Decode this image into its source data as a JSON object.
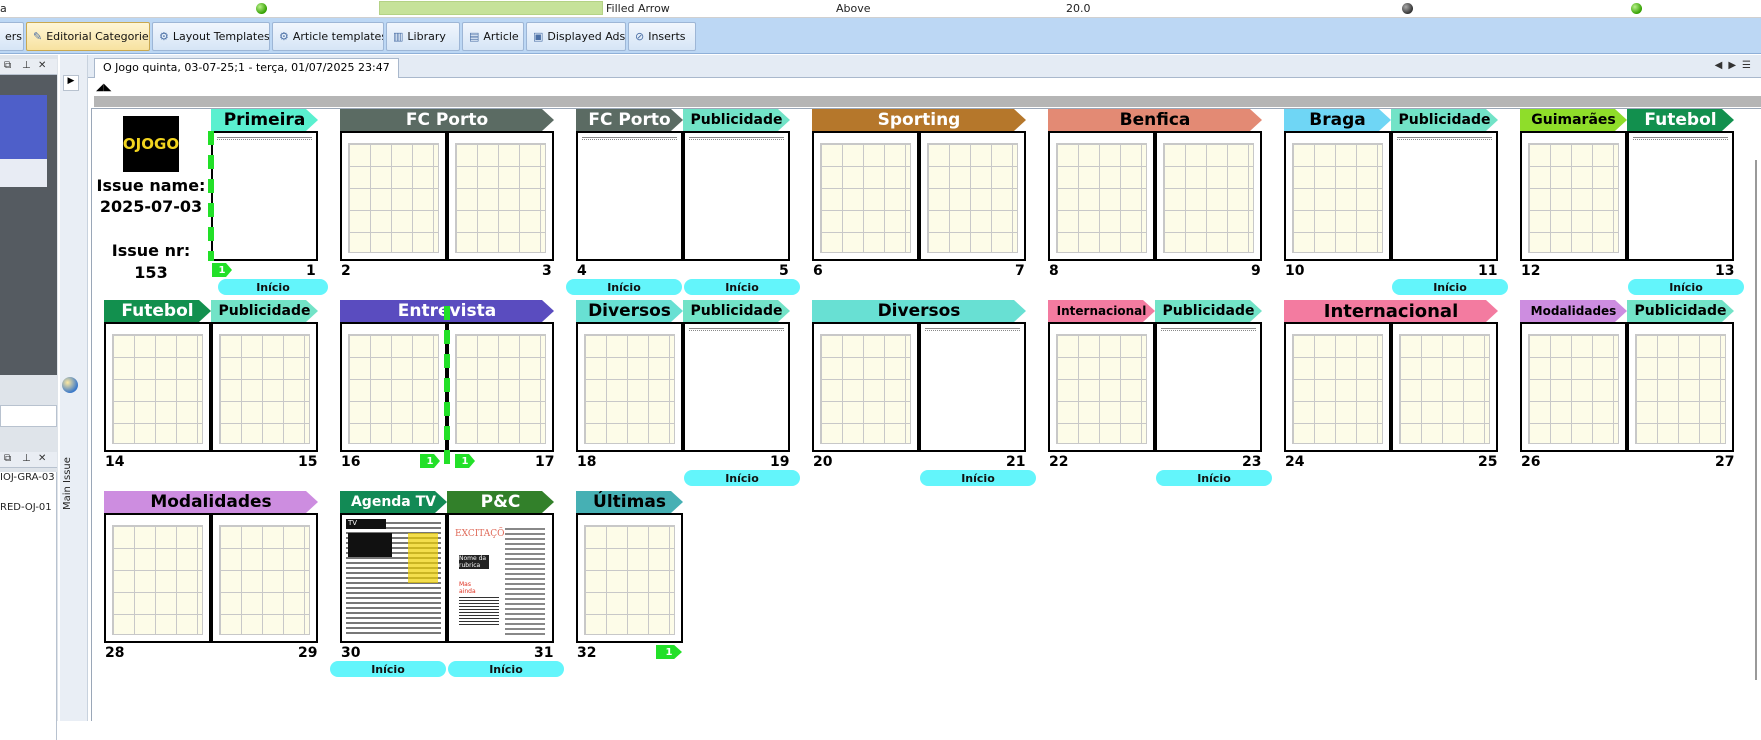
{
  "top_row": {
    "left_text": "a",
    "style_value": "Filled Arrow",
    "position_value": "Above",
    "size_value": "20.0"
  },
  "tabs": [
    {
      "label": "ers",
      "icon": "tab-icon"
    },
    {
      "label": "Editorial Categories",
      "icon": "pencil-icon"
    },
    {
      "label": "Layout Templates",
      "icon": "gear-icon"
    },
    {
      "label": "Article templates",
      "icon": "gear-icon"
    },
    {
      "label": "Library",
      "icon": "chart-icon"
    },
    {
      "label": "Article",
      "icon": "document-icon"
    },
    {
      "label": "Displayed Ads",
      "icon": "picture-icon"
    },
    {
      "label": "Inserts",
      "icon": "paperclip-icon"
    }
  ],
  "left_panel": {
    "items": [
      "IOJ-GRA-03",
      "RED-OJ-01"
    ]
  },
  "vertical_tab": "Main Issue",
  "document_tab": "O Jogo  quinta, 03-07-25;1 - terça, 01/07/2025 23:47",
  "issue": {
    "logo_text": "OJOGO",
    "name_label": "Issue name:",
    "name_value": "2025-07-03",
    "nr_label": "Issue nr:",
    "nr_value": "153"
  },
  "pages": {
    "p1": "1",
    "p2": "2",
    "p3": "3",
    "p4": "4",
    "p5": "5",
    "p6": "6",
    "p7": "7",
    "p8": "8",
    "p9": "9",
    "p10": "10",
    "p11": "11",
    "p12": "12",
    "p13": "13",
    "p14": "14",
    "p15": "15",
    "p16": "16",
    "p17": "17",
    "p18": "18",
    "p19": "19",
    "p20": "20",
    "p21": "21",
    "p22": "22",
    "p23": "23",
    "p24": "24",
    "p25": "25",
    "p26": "26",
    "p27": "27",
    "p28": "28",
    "p29": "29",
    "p30": "30",
    "p31": "31",
    "p32": "32"
  },
  "sections": {
    "primeira": "Primeira",
    "fcporto_a": "FC Porto",
    "fcporto_b": "FC Porto",
    "publicidade": "Publicidade",
    "sporting": "Sporting",
    "benfica": "Benfica",
    "braga": "Braga",
    "guimaraes": "Guimarães",
    "futebol": "Futebol",
    "entrevista": "Entrevista",
    "diversos": "Diversos",
    "internacional": "Internacional",
    "modalidades": "Modalidades",
    "agenda_tv": "Agenda TV",
    "pc": "P&C",
    "ultimas": "Últimas"
  },
  "section_colors": {
    "primeira": "#5af0cf",
    "fcporto": "#5b6b63",
    "publicidade": "#72e3c7",
    "sporting": "#b5772b",
    "benfica": "#e38a74",
    "braga": "#6fd6f5",
    "guimaraes": "#8fdd2a",
    "futebol": "#12904e",
    "entrevista": "#5a4cbf",
    "diversos": "#68e0d3",
    "internacional": "#f37ba0",
    "modalidades": "#cd8de0",
    "agenda_tv": "#128a55",
    "pc": "#32802a",
    "ultimas": "#46b0b4"
  },
  "inicio": "Início",
  "markers": {
    "m1": "1",
    "m2": "1",
    "m3": "1",
    "m4": "1"
  },
  "thumb30": {
    "title": "TV"
  },
  "thumb31": {
    "title": "EXCITAÇÕES",
    "box": "Nome da rubrica",
    "note": "Mas ainda encontra"
  }
}
